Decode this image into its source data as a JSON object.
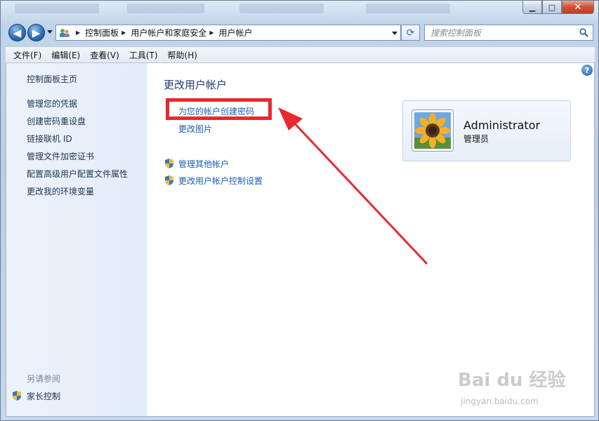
{
  "window": {
    "minimize_glyph": "▁",
    "maximize_glyph": "□",
    "close_glyph": "✕"
  },
  "nav": {
    "back_glyph": "◀",
    "forward_glyph": "▶",
    "breadcrumbs": [
      "控制面板",
      "用户帐户和家庭安全",
      "用户帐户"
    ],
    "search_placeholder": "搜索控制面板",
    "refresh_glyph": "⟳"
  },
  "menu": [
    "文件(F)",
    "编辑(E)",
    "查看(V)",
    "工具(T)",
    "帮助(H)"
  ],
  "sidebar": {
    "home": "控制面板主页",
    "links": [
      "管理您的凭据",
      "创建密码重设盘",
      "链接联机 ID",
      "管理文件加密证书",
      "配置高级用户配置文件属性",
      "更改我的环境变量"
    ],
    "see_also_label": "另请参阅",
    "see_also_link": "家长控制"
  },
  "main": {
    "title": "更改用户帐户",
    "create_password": "为您的帐户创建密码",
    "change_picture": "更改图片",
    "manage_other": "管理其他帐户",
    "uac_settings": "更改用户帐户控制设置"
  },
  "user": {
    "name": "Administrator",
    "role": "管理员"
  },
  "watermark": {
    "brand": "Bai du 经验",
    "url": "jingyan.baidu.com"
  },
  "colors": {
    "annotation_red": "#e8292e",
    "link_blue": "#1a5fb4"
  }
}
